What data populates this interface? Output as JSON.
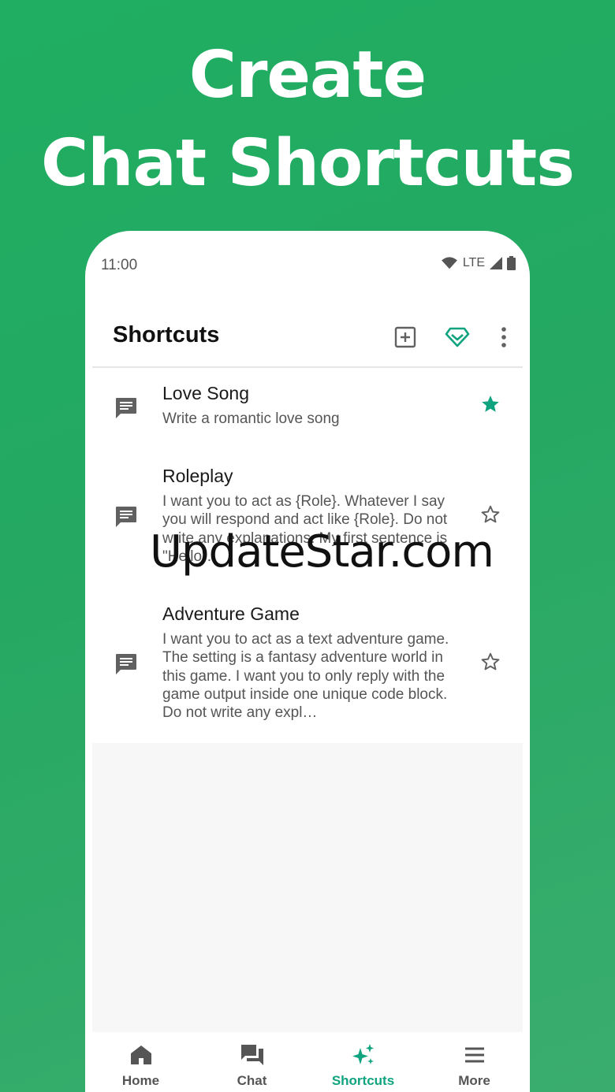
{
  "headline": {
    "line1": "Create",
    "line2": "Chat Shortcuts"
  },
  "status_bar": {
    "time": "11:00",
    "network": "LTE"
  },
  "app_bar": {
    "title": "Shortcuts"
  },
  "shortcuts": [
    {
      "name": "Love Song",
      "description": "Write a romantic love song",
      "starred": true
    },
    {
      "name": "Roleplay",
      "description": "I want you to act as {Role}. Whatever I say you will respond and act like {Role}. Do not write any explanations. My first sentence is \"Hello\".",
      "starred": false
    },
    {
      "name": "Adventure Game",
      "description": "I want you to act as a text adventure game. The setting is a fantasy adventure world in this game. I want you to only reply with the game output inside one unique code block. Do not write any expl…",
      "starred": false
    }
  ],
  "bottom_nav": [
    {
      "label": "Home",
      "icon": "home-icon",
      "active": false
    },
    {
      "label": "Chat",
      "icon": "chat-bubbles-icon",
      "active": false
    },
    {
      "label": "Shortcuts",
      "icon": "sparkles-icon",
      "active": true
    },
    {
      "label": "More",
      "icon": "menu-icon",
      "active": false
    }
  ],
  "watermark": "UpdateStar.com",
  "colors": {
    "accent": "#10a37f",
    "background": "#22ad64",
    "icon_gray": "#616161"
  }
}
